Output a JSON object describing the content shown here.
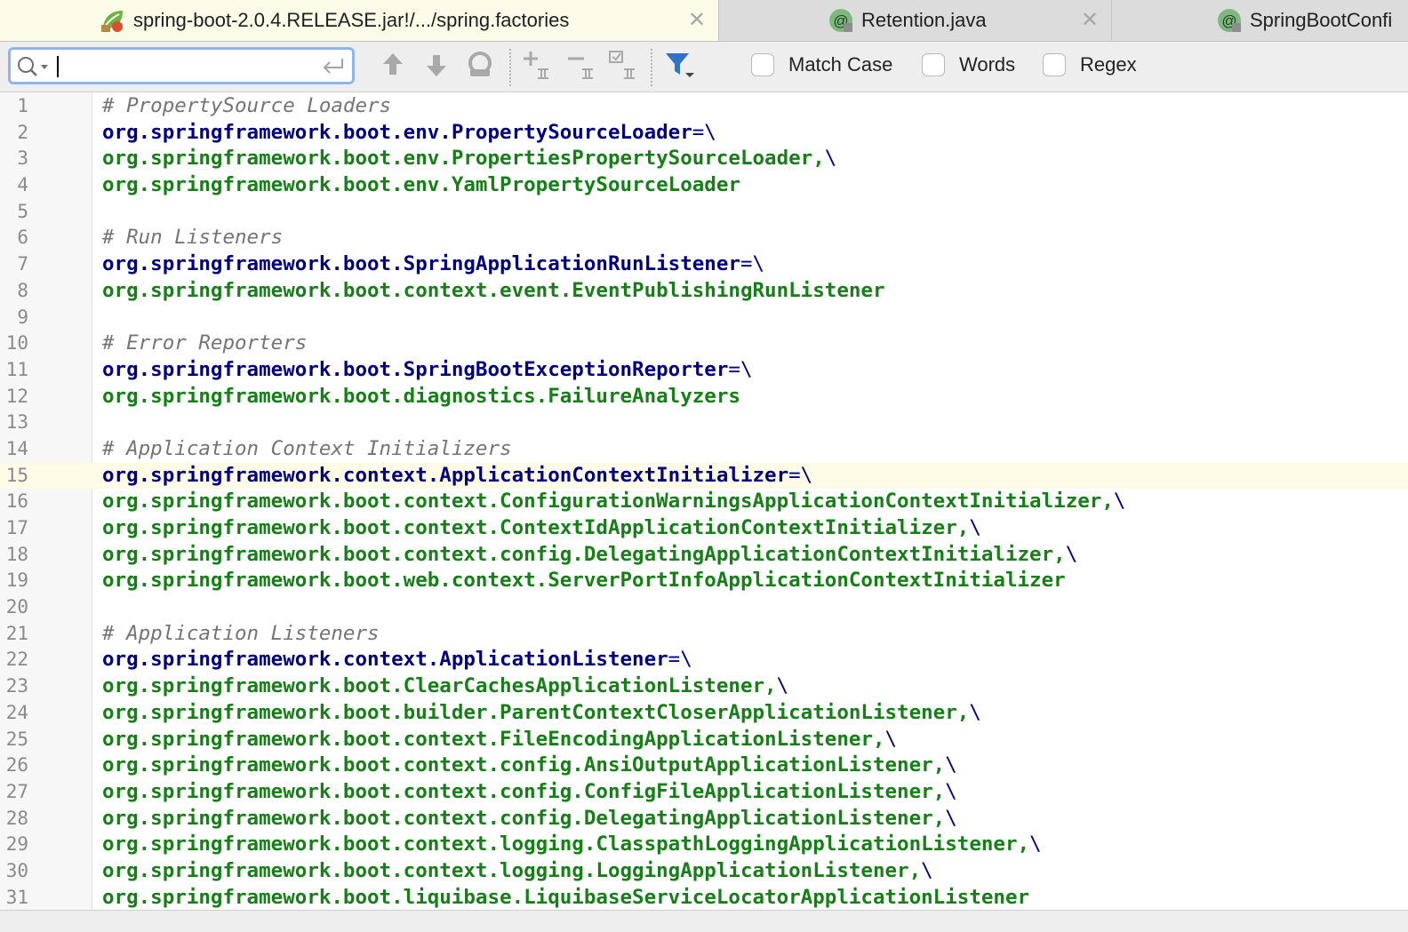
{
  "tabs": [
    {
      "label": "spring-boot-2.0.4.RELEASE.jar!/.../spring.factories",
      "icon": "spring-leaf-icon",
      "active": true
    },
    {
      "label": "Retention.java",
      "icon": "annotation-icon",
      "active": false
    },
    {
      "label": "SpringBootConfi",
      "icon": "annotation-icon",
      "active": false
    }
  ],
  "search": {
    "value": "",
    "placeholder": ""
  },
  "toolbar_icons": [
    "previous-occurrence-icon",
    "next-occurrence-icon",
    "find-all-icon",
    "add-selection-icon",
    "remove-selection-icon",
    "select-all-occurrences-icon",
    "filter-icon"
  ],
  "options": {
    "match_case": {
      "label": "Match Case",
      "checked": false
    },
    "words": {
      "label": "Words",
      "checked": false
    },
    "regex": {
      "label": "Regex",
      "checked": false
    }
  },
  "colors": {
    "comment": "#747474",
    "key": "#000080",
    "value": "#177f17",
    "current_line": "#fdfbe6",
    "search_focus": "#8fb6ec"
  },
  "current_line": 15,
  "editor": {
    "lines": [
      {
        "n": "1",
        "parts": [
          {
            "t": "# PropertySource Loaders",
            "k": "comment"
          }
        ]
      },
      {
        "n": "2",
        "parts": [
          {
            "t": "org.springframework.boot.env.PropertySourceLoader",
            "k": "key"
          },
          {
            "t": "=\\",
            "k": "sep"
          }
        ]
      },
      {
        "n": "3",
        "parts": [
          {
            "t": "org.springframework.boot.env.PropertiesPropertySourceLoader,",
            "k": "val"
          },
          {
            "t": "\\",
            "k": "sep"
          }
        ]
      },
      {
        "n": "4",
        "parts": [
          {
            "t": "org.springframework.boot.env.YamlPropertySourceLoader",
            "k": "val"
          }
        ]
      },
      {
        "n": "5",
        "parts": []
      },
      {
        "n": "6",
        "parts": [
          {
            "t": "# Run Listeners",
            "k": "comment"
          }
        ]
      },
      {
        "n": "7",
        "parts": [
          {
            "t": "org.springframework.boot.SpringApplicationRunListener",
            "k": "key"
          },
          {
            "t": "=\\",
            "k": "sep"
          }
        ]
      },
      {
        "n": "8",
        "parts": [
          {
            "t": "org.springframework.boot.context.event.EventPublishingRunListener",
            "k": "val"
          }
        ]
      },
      {
        "n": "9",
        "parts": []
      },
      {
        "n": "10",
        "parts": [
          {
            "t": "# Error Reporters",
            "k": "comment"
          }
        ]
      },
      {
        "n": "11",
        "parts": [
          {
            "t": "org.springframework.boot.SpringBootExceptionReporter",
            "k": "key"
          },
          {
            "t": "=\\",
            "k": "sep"
          }
        ]
      },
      {
        "n": "12",
        "parts": [
          {
            "t": "org.springframework.boot.diagnostics.FailureAnalyzers",
            "k": "val"
          }
        ]
      },
      {
        "n": "13",
        "parts": []
      },
      {
        "n": "14",
        "parts": [
          {
            "t": "# Application Context Initializers",
            "k": "comment"
          }
        ]
      },
      {
        "n": "15",
        "parts": [
          {
            "t": "org.springframework.context.ApplicationContextInitializer",
            "k": "key"
          },
          {
            "t": "=\\",
            "k": "sep"
          }
        ]
      },
      {
        "n": "16",
        "parts": [
          {
            "t": "org.springframework.boot.context.ConfigurationWarningsApplicationContextInitializer,",
            "k": "val"
          },
          {
            "t": "\\",
            "k": "sep"
          }
        ]
      },
      {
        "n": "17",
        "parts": [
          {
            "t": "org.springframework.boot.context.ContextIdApplicationContextInitializer,",
            "k": "val"
          },
          {
            "t": "\\",
            "k": "sep"
          }
        ]
      },
      {
        "n": "18",
        "parts": [
          {
            "t": "org.springframework.boot.context.config.DelegatingApplicationContextInitializer,",
            "k": "val"
          },
          {
            "t": "\\",
            "k": "sep"
          }
        ]
      },
      {
        "n": "19",
        "parts": [
          {
            "t": "org.springframework.boot.web.context.ServerPortInfoApplicationContextInitializer",
            "k": "val"
          }
        ]
      },
      {
        "n": "20",
        "parts": []
      },
      {
        "n": "21",
        "parts": [
          {
            "t": "# Application Listeners",
            "k": "comment"
          }
        ]
      },
      {
        "n": "22",
        "parts": [
          {
            "t": "org.springframework.context.ApplicationListener",
            "k": "key"
          },
          {
            "t": "=\\",
            "k": "sep"
          }
        ]
      },
      {
        "n": "23",
        "parts": [
          {
            "t": "org.springframework.boot.ClearCachesApplicationListener,",
            "k": "val"
          },
          {
            "t": "\\",
            "k": "sep"
          }
        ]
      },
      {
        "n": "24",
        "parts": [
          {
            "t": "org.springframework.boot.builder.ParentContextCloserApplicationListener,",
            "k": "val"
          },
          {
            "t": "\\",
            "k": "sep"
          }
        ]
      },
      {
        "n": "25",
        "parts": [
          {
            "t": "org.springframework.boot.context.FileEncodingApplicationListener,",
            "k": "val"
          },
          {
            "t": "\\",
            "k": "sep"
          }
        ]
      },
      {
        "n": "26",
        "parts": [
          {
            "t": "org.springframework.boot.context.config.AnsiOutputApplicationListener,",
            "k": "val"
          },
          {
            "t": "\\",
            "k": "sep"
          }
        ]
      },
      {
        "n": "27",
        "parts": [
          {
            "t": "org.springframework.boot.context.config.ConfigFileApplicationListener,",
            "k": "val"
          },
          {
            "t": "\\",
            "k": "sep"
          }
        ]
      },
      {
        "n": "28",
        "parts": [
          {
            "t": "org.springframework.boot.context.config.DelegatingApplicationListener,",
            "k": "val"
          },
          {
            "t": "\\",
            "k": "sep"
          }
        ]
      },
      {
        "n": "29",
        "parts": [
          {
            "t": "org.springframework.boot.context.logging.ClasspathLoggingApplicationListener,",
            "k": "val"
          },
          {
            "t": "\\",
            "k": "sep"
          }
        ]
      },
      {
        "n": "30",
        "parts": [
          {
            "t": "org.springframework.boot.context.logging.LoggingApplicationListener,",
            "k": "val"
          },
          {
            "t": "\\",
            "k": "sep"
          }
        ]
      },
      {
        "n": "31",
        "parts": [
          {
            "t": "org.springframework.boot.liquibase.LiquibaseServiceLocatorApplicationListener",
            "k": "val"
          }
        ]
      }
    ]
  }
}
